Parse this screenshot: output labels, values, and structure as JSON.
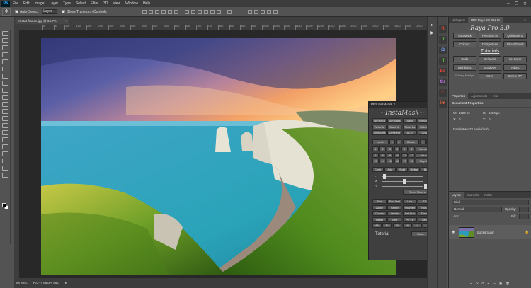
{
  "app": {
    "logo": "Ps",
    "menu": [
      "File",
      "Edit",
      "Image",
      "Layer",
      "Type",
      "Select",
      "Filter",
      "3D",
      "View",
      "Window",
      "Help"
    ],
    "window_controls": [
      "–",
      "❐",
      "✕"
    ]
  },
  "options_bar": {
    "auto_select_label": "Auto-Select:",
    "auto_select_value": "Layer",
    "transform_label": "Show Transform Controls"
  },
  "document": {
    "tab_title": "etretat-france.jpg @ 66.7% (RGB/8)",
    "tab_close": "×",
    "zoom": "66.67%",
    "doc_info": "Doc: 7.89M/7.89M",
    "ruler_marks": [
      "0",
      "50",
      "100",
      "150",
      "200",
      "250",
      "300",
      "350",
      "400",
      "450",
      "500",
      "550",
      "600",
      "650",
      "700",
      "750",
      "800",
      "850",
      "900",
      "950",
      "1000",
      "1050",
      "1100",
      "1150",
      "1200",
      "1250",
      "1300",
      "1350",
      "1400",
      "1450",
      "1500",
      "1550",
      "1600",
      "1650",
      "1700",
      "1750",
      "1800",
      "1850"
    ]
  },
  "instamask": {
    "header": "RPS InstaMask 2",
    "close": "×",
    "title": "~InstaMask~",
    "row1": [
      "Sim RGB",
      "Sim Mask",
      "Align",
      "Selecte M"
    ],
    "row2": [
      "White M",
      "Black M",
      "Show La",
      "Hide La"
    ],
    "row3": [
      "Inter Area",
      "Deselect",
      "ACR",
      "Undo"
    ],
    "sel_row": [
      "Lumin",
      "<",
      "2",
      "Colour",
      "<",
      ">"
    ],
    "num_rows": [
      [
        "1",
        "2",
        "3",
        "4",
        "5",
        "6",
        "Manual"
      ],
      [
        "7",
        "8",
        "9",
        "10",
        "11",
        "12",
        "Set M"
      ],
      [
        "13",
        "14",
        "15",
        "16",
        "17",
        "18",
        "Stop M"
      ]
    ],
    "tools_row": [
      "Contr",
      "Add",
      "Subt",
      "Refine",
      "Blur"
    ],
    "sliders": [
      {
        "label": "L",
        "value": ""
      },
      {
        "label": "M",
        "value": "50"
      },
      {
        "label": "H",
        "value": "255"
      }
    ],
    "reset": "Reset Sliders",
    "action_rows": [
      [
        "Test",
        "End Test",
        "Use",
        "Tilt"
      ],
      [
        "Apply",
        "Select",
        "Sharpen",
        "Noise"
      ],
      [
        "Curves",
        "Levels",
        "Sat Hue",
        "Dmon"
      ],
      [
        "Detail",
        "Vibrt",
        "PH Fill",
        "Save"
      ],
      [
        "Wh",
        "Bl",
        "Sh",
        "Hi",
        "<",
        ">"
      ]
    ],
    "tutorial": "Tutorial",
    "close_button": "Close"
  },
  "dock": {
    "top_tabs": [
      "Histogram",
      "RPS Raya Pro 3 HUB"
    ],
    "top_menu": "≡",
    "icon_letters": [
      "R",
      "ff",
      "Ω",
      "ff",
      "Ds",
      "Cs",
      "C",
      "im"
    ],
    "icon_colors": [
      "#e8453c",
      "#61c33d",
      "#7aa7ff",
      "#61c33d",
      "#e8453c",
      "#d27cff",
      "#e8453c",
      "#ff6b3a"
    ]
  },
  "raya": {
    "title": "~Raya Pro 3.0~",
    "row1": [
      "InstaMask",
      "Precision M",
      "Quick Blend"
    ],
    "row2": [
      "Colours",
      "Dodge Burn",
      "Filters/Finish"
    ],
    "tutorials": "Tutorials",
    "row3": [
      "Undo",
      "Del Mask",
      "Sel Layer"
    ],
    "row4": [
      "Highlights",
      "Shadows",
      "Adjust"
    ],
    "row5": [
      "& Jimmy Mcintyre",
      "Save",
      "Delete RP"
    ]
  },
  "properties": {
    "tabs": [
      "Properties",
      "Adjustments",
      "Info"
    ],
    "title": "Document Properties",
    "w_label": "W:",
    "w_value": "1920 px",
    "h_label": "H:",
    "h_value": "1280 px",
    "x_label": "X:",
    "x_value": "0",
    "y_label": "Y:",
    "y_value": "0",
    "resolution": "Resolution: 72 pixels/inch"
  },
  "layers": {
    "tabs": [
      "Layers",
      "Channels",
      "Paths"
    ],
    "kind": "Kind",
    "blend": "Normal",
    "opacity": "Opacity:",
    "lock": "Lock:",
    "fill": "Fill:",
    "layer_name": "Background"
  }
}
